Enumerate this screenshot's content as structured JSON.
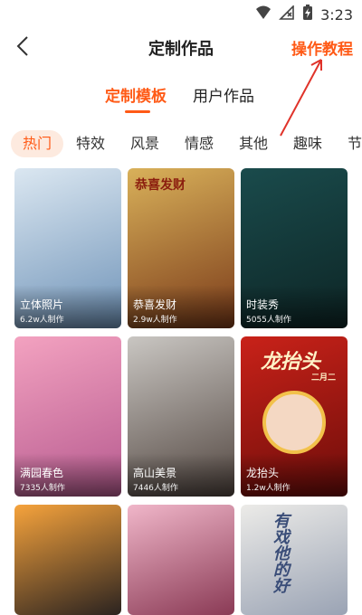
{
  "status_bar": {
    "time": "3:23",
    "icons": [
      "wifi-icon",
      "no-signal-icon",
      "battery-charging-icon"
    ]
  },
  "header": {
    "title": "定制作品",
    "tutorial_link": "操作教程",
    "back_icon": "back-arrow-icon"
  },
  "main_tabs": [
    {
      "label": "定制模板",
      "active": true
    },
    {
      "label": "用户作品",
      "active": false
    }
  ],
  "categories": [
    {
      "label": "热门",
      "active": true
    },
    {
      "label": "特效",
      "active": false
    },
    {
      "label": "风景",
      "active": false
    },
    {
      "label": "情感",
      "active": false
    },
    {
      "label": "其他",
      "active": false
    },
    {
      "label": "趣味",
      "active": false
    },
    {
      "label": "节",
      "active": false
    }
  ],
  "templates": [
    {
      "title": "立体照片",
      "count": "6.2w人制作",
      "colors": [
        "#dbe7f1",
        "#6f93b8"
      ]
    },
    {
      "title": "恭喜发财",
      "count": "2.9w人制作",
      "colors": [
        "#d9b15a",
        "#7a3a19"
      ]
    },
    {
      "title": "时装秀",
      "count": "5055人制作",
      "colors": [
        "#1a4b4c",
        "#0d2525"
      ]
    },
    {
      "title": "满园春色",
      "count": "7335人制作",
      "colors": [
        "#f3a2c0",
        "#b65a8f"
      ]
    },
    {
      "title": "高山美景",
      "count": "7446人制作",
      "colors": [
        "#c9c6c2",
        "#524640"
      ]
    },
    {
      "title": "龙抬头",
      "count": "1.2w人制作",
      "colors": [
        "#c92219",
        "#6d0d0a"
      ]
    },
    {
      "title": "",
      "count": "",
      "colors": [
        "#f6a33c",
        "#2b2320"
      ]
    },
    {
      "title": "",
      "count": "",
      "colors": [
        "#f0b6c9",
        "#8a3a55"
      ]
    },
    {
      "title": "",
      "count": "",
      "colors": [
        "#ecebe8",
        "#9aa3b4"
      ]
    }
  ],
  "card_overlays": {
    "fortune_text": "恭喜发财",
    "dragon_text": "龙抬头",
    "dragon_sub": "二月二",
    "calligraphy_text": "有戏他的好"
  },
  "colors": {
    "accent": "#ff5a16",
    "chip_bg": "#fdeadf",
    "annotation_red": "#e0332a"
  }
}
